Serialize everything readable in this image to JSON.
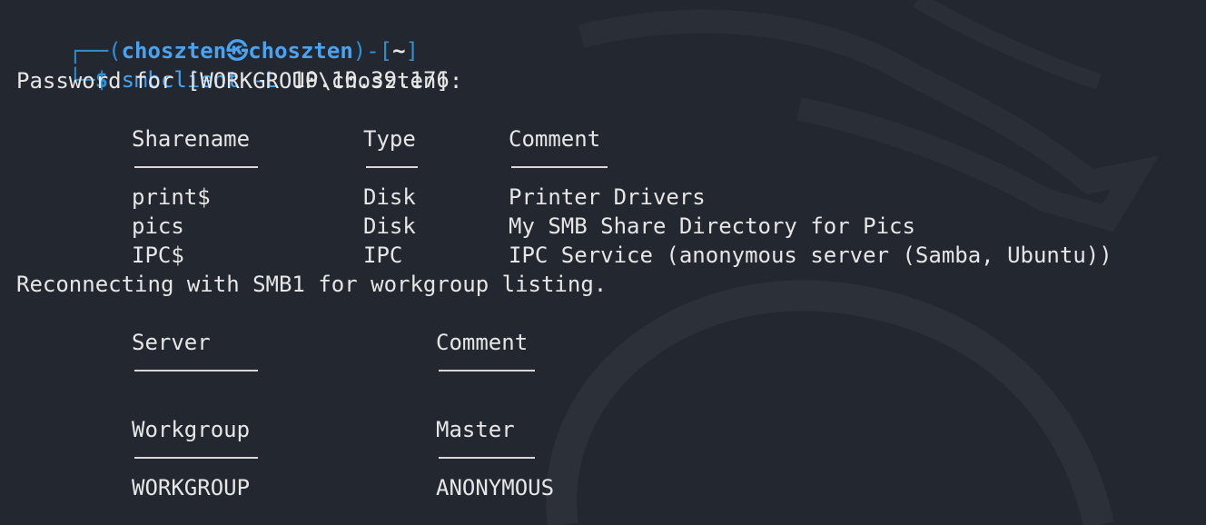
{
  "prompt": {
    "frame_top_open": "┌──(",
    "user": "choszten",
    "at_symbol": "㉿",
    "host": "choszten",
    "frame_mid": ")-[",
    "cwd": "~",
    "frame_close": "]",
    "frame_bottom": "└─",
    "dollar": "$",
    "command": "smbclient",
    "flag": "-L",
    "target": "10.10.39.176"
  },
  "password_prompt": "Password for [WORKGROUP\\choszten]:",
  "shares": {
    "headers": [
      "Sharename",
      "Type",
      "Comment"
    ],
    "rows": [
      [
        "print$",
        "Disk",
        "Printer Drivers"
      ],
      [
        "pics",
        "Disk",
        "My SMB Share Directory for Pics"
      ],
      [
        "IPC$",
        "IPC",
        "IPC Service (anonymous server (Samba, Ubuntu))"
      ]
    ]
  },
  "reconnect_msg": "Reconnecting with SMB1 for workgroup listing.",
  "servers": {
    "headers": [
      "Server",
      "Comment"
    ]
  },
  "workgroups": {
    "headers": [
      "Workgroup",
      "Master"
    ],
    "rows": [
      [
        "WORKGROUP",
        "ANONYMOUS"
      ]
    ]
  },
  "colors": {
    "background": "#23272f",
    "prompt_blue": "#2f8fd6",
    "text": "#e6e6e6"
  }
}
